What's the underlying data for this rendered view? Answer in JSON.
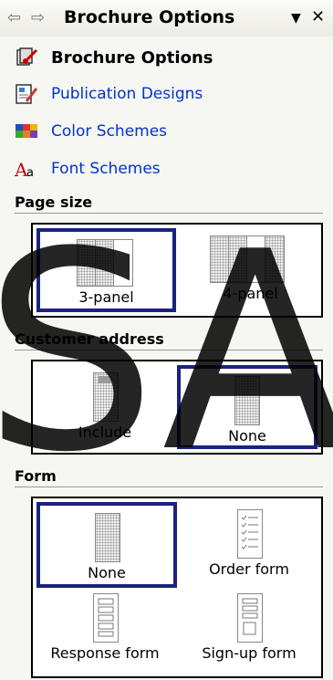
{
  "pane": {
    "title": "Brochure Options",
    "back_icon": "back-arrow-icon",
    "forward_icon": "forward-arrow-icon",
    "menu_icon": "dropdown-icon",
    "close_icon": "close-icon"
  },
  "tasks": {
    "header": "Brochure Options",
    "items": [
      {
        "label": "Publication Designs",
        "icon": "publication-designs-icon"
      },
      {
        "label": "Color Schemes",
        "icon": "color-schemes-icon"
      },
      {
        "label": "Font Schemes",
        "icon": "font-schemes-icon"
      }
    ]
  },
  "page_size": {
    "heading": "Page size",
    "options": [
      {
        "label": "3-panel",
        "selected": true
      },
      {
        "label": "4-panel",
        "selected": false
      }
    ]
  },
  "customer_address": {
    "heading": "Customer address",
    "options": [
      {
        "label": "Include",
        "selected": false
      },
      {
        "label": "None",
        "selected": true
      }
    ]
  },
  "form": {
    "heading": "Form",
    "options": [
      {
        "label": "None",
        "selected": true
      },
      {
        "label": "Order form",
        "selected": false
      },
      {
        "label": "Response form",
        "selected": false
      },
      {
        "label": "Sign-up form",
        "selected": false
      }
    ]
  },
  "watermark": "SA",
  "colors": {
    "selection": "#1a237e",
    "link": "#0033cc",
    "pane_bg": "#f6f6f2"
  }
}
